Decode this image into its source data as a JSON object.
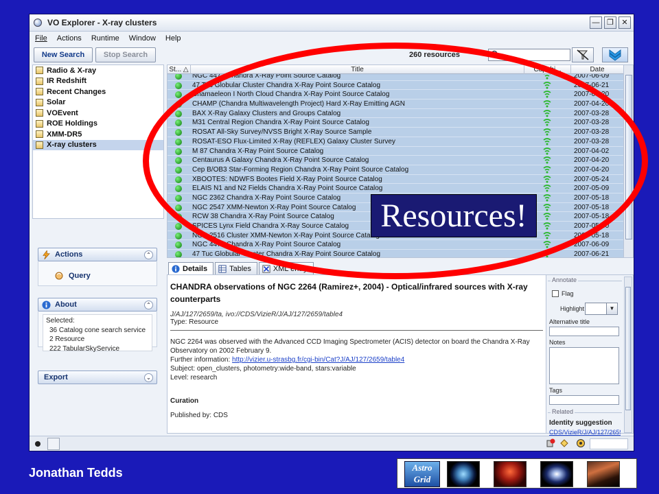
{
  "window": {
    "title": "VO Explorer - X-ray clusters"
  },
  "menu": [
    "File",
    "Actions",
    "Runtime",
    "Window",
    "Help"
  ],
  "toolbar": {
    "new_search": "New Search",
    "stop_search": "Stop Search",
    "count": "260 resources",
    "search_value": ""
  },
  "lists": [
    {
      "label": "Radio & X-ray"
    },
    {
      "label": "IR Redshift"
    },
    {
      "label": "Recent Changes"
    },
    {
      "label": "Solar"
    },
    {
      "label": "VOEvent"
    },
    {
      "label": "ROE Holdings"
    },
    {
      "label": "XMM-DR5"
    },
    {
      "label": "X-ray clusters",
      "selected": true
    }
  ],
  "actions": {
    "header": "Actions",
    "query": "Query"
  },
  "about": {
    "header": "About",
    "selected": "Selected:",
    "lines": [
      "36 Catalog cone search service",
      "2 Resource",
      "222 TabularSkyService"
    ]
  },
  "export": {
    "header": "Export"
  },
  "table": {
    "headers": {
      "status": "St...",
      "title": "Title",
      "capability": "Capabi...",
      "date": "Date"
    },
    "rows": [
      {
        "title": "NGC 4472 Chandra X-Ray Point Source Catalog",
        "date": "2007-06-09"
      },
      {
        "title": "47 Tuc Globular Cluster Chandra X-Ray Point Source Catalog",
        "date": "2007-06-21"
      },
      {
        "title": "Chamaeleon I North Cloud Chandra X-Ray Point Source Catalog",
        "date": "2007-04-20"
      },
      {
        "title": "CHAMP (Chandra Multiwavelength Project) Hard X-Ray Emitting AGN",
        "date": "2007-04-20"
      },
      {
        "title": "BAX X-Ray Galaxy Clusters and Groups Catalog",
        "date": "2007-03-28"
      },
      {
        "title": "M31 Central Region Chandra X-Ray Point Source Catalog",
        "date": "2007-03-28"
      },
      {
        "title": "ROSAT All-Sky Survey/NVSS Bright X-Ray Source Sample",
        "date": "2007-03-28"
      },
      {
        "title": "ROSAT-ESO Flux-Limited X-Ray (REFLEX) Galaxy Cluster Survey",
        "date": "2007-03-28"
      },
      {
        "title": "M 87 Chandra X-Ray Point Source Catalog",
        "date": "2007-04-02"
      },
      {
        "title": "Centaurus A Galaxy Chandra X-Ray Point Source Catalog",
        "date": "2007-04-20"
      },
      {
        "title": "Cep B/OB3 Star-Forming Region Chandra X-Ray Point Source Catalog",
        "date": "2007-04-20"
      },
      {
        "title": "XBOOTES: NDWFS Bootes Field X-Ray Point Source Catalog",
        "date": "2007-05-24"
      },
      {
        "title": "ELAIS N1 and N2 Fields Chandra X-Ray Point Source Catalog",
        "date": "2007-05-09"
      },
      {
        "title": "NGC 2362 Chandra X-Ray Point Source Catalog",
        "date": "2007-05-18"
      },
      {
        "title": "NGC 2547 XMM-Newton X-Ray Point Source Catalog",
        "date": "2007-05-18"
      },
      {
        "title": "RCW 38 Chandra X-Ray Point Source Catalog",
        "date": "2007-05-18"
      },
      {
        "title": "SPICES Lynx Field Chandra X-Ray Source Catalog",
        "date": "2007-05-30"
      },
      {
        "title": "NGC 2516 Cluster XMM-Newton X-Ray Point Source Catalog",
        "date": "2007-05-18"
      },
      {
        "title": "NGC 4472 Chandra X-Ray Point Source Catalog",
        "date": "2007-06-09"
      },
      {
        "title": "47 Tuc Globular Cluster Chandra X-Ray Point Source Catalog",
        "date": "2007-06-21"
      }
    ]
  },
  "tabs": [
    "Details",
    "Tables",
    "XML entry"
  ],
  "detail": {
    "title": "CHANDRA observations of NGC 2264 (Ramirez+, 2004) - Optical/infrared sources with X-ray counterparts",
    "ids": "J/AJ/127/2659/ta, ivo://CDS/VizieR/J/AJ/127/2659/table4",
    "type": "Type: Resource",
    "description": "NGC 2264 was observed with the Advanced CCD Imaging Spectrometer (ACIS) detector on board the Chandra X-Ray Observatory on 2002 February 9.",
    "further_label": "Further information: ",
    "further_link": "http://vizier.u-strasbg.fr/cgi-bin/Cat?J/AJ/127/2659/table4",
    "subject": "Subject: open_clusters, photometry:wide-band, stars:variable",
    "level": "Level: research",
    "curation": "Curation",
    "published": "Published by: CDS"
  },
  "annotate": {
    "legend": "Annotate",
    "flag": "Flag",
    "highlight": "Highlight",
    "alt_title": "Alternative title",
    "notes": "Notes",
    "tags": "Tags",
    "related": "Related",
    "identity": "Identity suggestion",
    "identity_value": "CDS/VizieR/J/AJ/127/2659"
  },
  "overlay": {
    "label": "Resources!",
    "accent": "#ff0000"
  },
  "footer": {
    "author": "Jonathan Tedds",
    "logo_text": "Astro Grid"
  }
}
